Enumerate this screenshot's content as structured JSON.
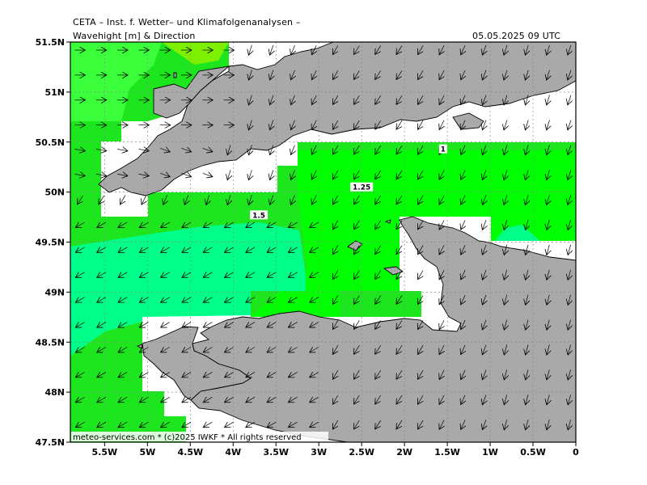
{
  "header": {
    "title": "CETA – Inst. f. Wetter– und Klimafolgenanalysen –",
    "subtitle": "Wavehight [m] & Direction",
    "timestamp": "05.05.2025 09 UTC"
  },
  "map": {
    "lon_range": [
      -5.9,
      0.0
    ],
    "lat_range": [
      47.5,
      51.5
    ],
    "lat_ticks": [
      "51.5N",
      "51N",
      "50.5N",
      "50N",
      "49.5N",
      "49N",
      "48.5N",
      "48N",
      "47.5N"
    ],
    "lon_ticks": [
      "5.5W",
      "5W",
      "4.5W",
      "4W",
      "3.5W",
      "3W",
      "2.5W",
      "2W",
      "1.5W",
      "1W",
      "0.5W",
      "0"
    ],
    "contour_labels": [
      {
        "text": "1",
        "lon": -1.55,
        "lat": 50.42
      },
      {
        "text": "1.25",
        "lon": -2.5,
        "lat": 50.04
      },
      {
        "text": "1.5",
        "lon": -3.7,
        "lat": 49.76
      }
    ],
    "credit": "meteo-services.com * (c)2025 IWKF * All rights reserved",
    "colors": {
      "land": "#a9a9a9",
      "sea_low": "#1ee61e",
      "sea_mid": "#00ff00",
      "sea_high": "#00ff88",
      "sea_peak": "#7cf000",
      "arrow": "#000000"
    }
  }
}
